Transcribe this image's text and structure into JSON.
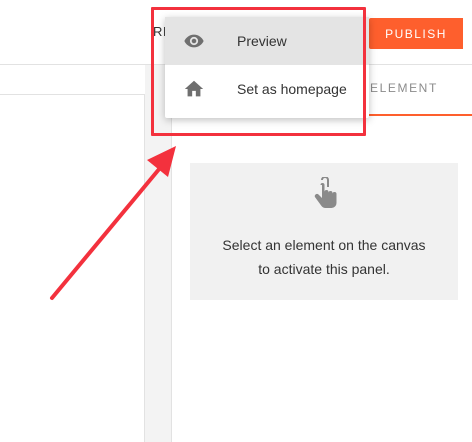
{
  "topbar": {
    "partial_label": "RI",
    "publish_label": "PUBLISH"
  },
  "panel": {
    "tab_label": "ELEMENT",
    "empty_line1": "Select an element on the canvas",
    "empty_line2": "to activate this panel."
  },
  "menu": {
    "items": [
      {
        "label": "Preview",
        "icon": "eye-icon"
      },
      {
        "label": "Set as homepage",
        "icon": "home-icon"
      }
    ]
  },
  "colors": {
    "accent": "#fe5f2d",
    "annotation": "#f3313d",
    "hover_bg": "#e4e4e4"
  }
}
